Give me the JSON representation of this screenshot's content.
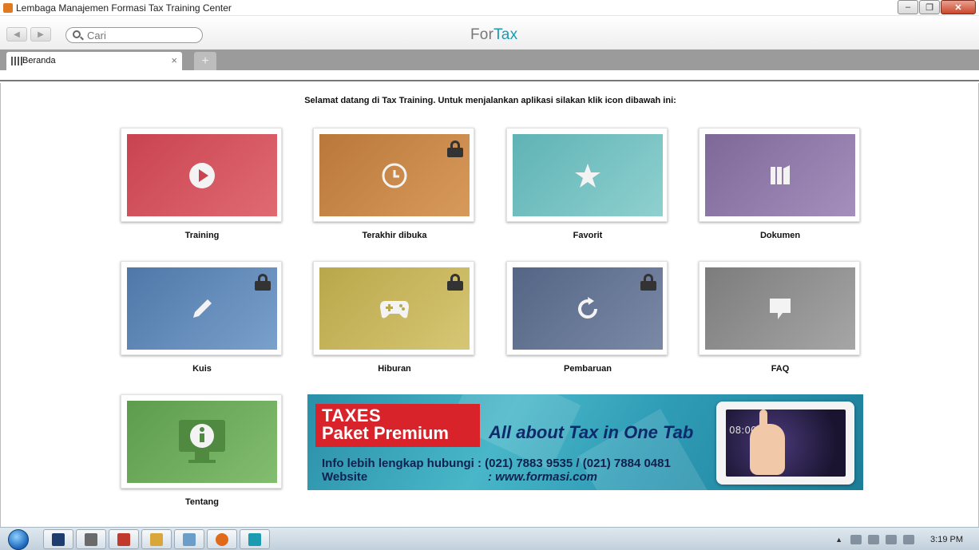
{
  "window": {
    "title": "Lembaga Manajemen Formasi Tax Training Center",
    "buttons": {
      "minimize": "–",
      "restore": "❐",
      "close": "✕"
    }
  },
  "toolbar": {
    "back_icon": "◀",
    "forward_icon": "▶",
    "search_placeholder": "Cari",
    "brand_for": "For",
    "brand_tax": "Tax"
  },
  "tabs": {
    "active_label": "Beranda",
    "close_glyph": "×",
    "new_tab_glyph": "+"
  },
  "home": {
    "welcome": "Selamat datang di Tax Training. Untuk menjalankan aplikasi silakan klik icon dibawah ini:",
    "tiles": [
      {
        "label": "Training",
        "color": "#d9535f",
        "icon": "play-icon",
        "locked": false
      },
      {
        "label": "Terakhir dibuka",
        "color": "#c98a4a",
        "icon": "clock-icon",
        "locked": true
      },
      {
        "label": "Favorit",
        "color": "#6bbfbf",
        "icon": "star-icon",
        "locked": false
      },
      {
        "label": "Dokumen",
        "color": "#8e77a8",
        "icon": "book-icon",
        "locked": false
      },
      {
        "label": "Kuis",
        "color": "#5d86b5",
        "icon": "pencil-icon",
        "locked": true
      },
      {
        "label": "Hiburan",
        "color": "#c7b65a",
        "icon": "gamepad-icon",
        "locked": true
      },
      {
        "label": "Pembaruan",
        "color": "#5f6f8c",
        "icon": "refresh-icon",
        "locked": true
      },
      {
        "label": "FAQ",
        "color": "#8c8c8c",
        "icon": "speech-bubble-icon",
        "locked": false
      },
      {
        "label": "Tentang",
        "color": "#6aa85a",
        "icon": "info-icon",
        "locked": false
      }
    ]
  },
  "banner": {
    "title_line1": "TAXES",
    "title_line2": "Paket Premium",
    "slogan": "All about Tax in One Tab",
    "info": "Info lebih lengkap hubungi : (021) 7883 9535 / (021) 7884 0481",
    "website_label": "Website",
    "website_url": ": www.formasi.com",
    "tablet_clock": "08:00"
  },
  "taskbar": {
    "items": [
      {
        "name": "photoshop",
        "color": "#1f3c6e"
      },
      {
        "name": "media",
        "color": "#6a6a6a"
      },
      {
        "name": "pdf",
        "color": "#c0392b"
      },
      {
        "name": "explorer",
        "color": "#d9a63a"
      },
      {
        "name": "window",
        "color": "#6a9ec9"
      },
      {
        "name": "firefox",
        "color": "#e06a1a"
      },
      {
        "name": "fortax",
        "color": "#1a9bb0"
      }
    ],
    "clock": "3:19 PM"
  }
}
